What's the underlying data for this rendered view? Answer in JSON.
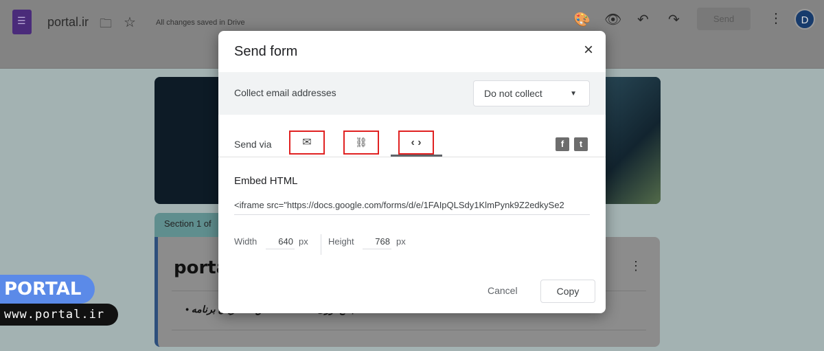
{
  "header": {
    "title": "portal.ir",
    "save_status": "All changes saved in Drive",
    "send_label": "Send",
    "avatar_initial": "D"
  },
  "form": {
    "section_label": "Section 1 of",
    "title": "porta",
    "bullet_text": "جمع آوری اطلاعات تماس مشتریان برنامه"
  },
  "dialog": {
    "title": "Send form",
    "close_icon": "×",
    "collect_label": "Collect email addresses",
    "collect_value": "Do not collect",
    "send_via_label": "Send via",
    "tabs": [
      {
        "icon": "email-icon",
        "glyph": "✉"
      },
      {
        "icon": "link-icon",
        "glyph": "🔗"
      },
      {
        "icon": "embed-icon",
        "glyph": "‹ ›",
        "active": true
      }
    ],
    "embed_title": "Embed HTML",
    "embed_code": "<iframe src=\"https://docs.google.com/forms/d/e/1FAIpQLSdy1KlmPynk9Z2edkySe2",
    "width_label": "Width",
    "width_value": "640",
    "height_label": "Height",
    "height_value": "768",
    "unit": "px",
    "cancel_label": "Cancel",
    "copy_label": "Copy"
  },
  "watermark": {
    "brand": "PORTAL",
    "url": "www.portal.ir"
  }
}
